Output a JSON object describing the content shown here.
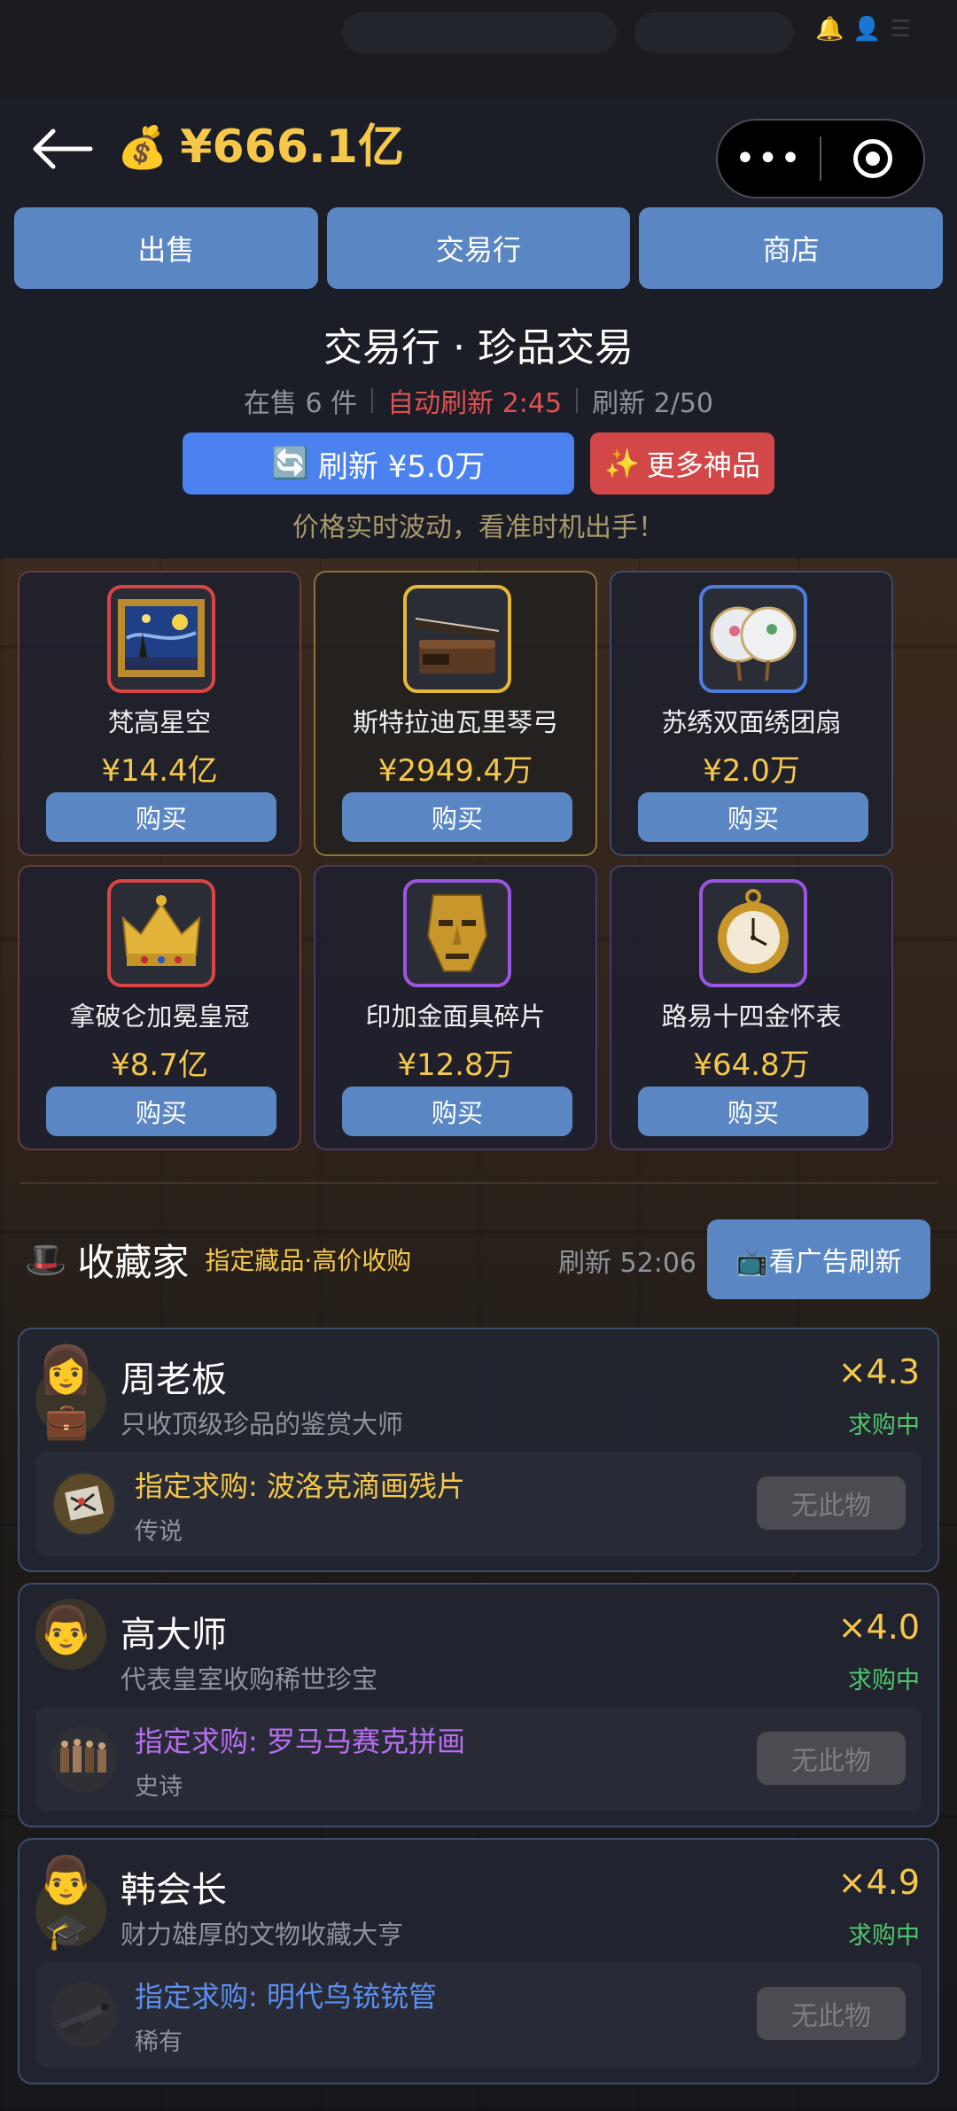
{
  "header": {
    "money": "¥666.1亿",
    "money_icon": "money-bag-icon"
  },
  "tabs": [
    {
      "label": "出售"
    },
    {
      "label": "交易行"
    },
    {
      "label": "商店"
    }
  ],
  "market": {
    "title": "交易行 · 珍品交易",
    "on_sale": "在售 6 件",
    "auto_refresh": "自动刷新 2:45",
    "refresh_count": "刷新 2/50",
    "refresh_button": "刷新 ¥5.0万",
    "more_button": "更多神品",
    "tip": "价格实时波动，看准时机出手！"
  },
  "items": [
    {
      "name": "梵高星空",
      "price": "¥14.4亿",
      "buy": "购买",
      "icon": "starry-night-painting-icon",
      "rarity_color": "#d94545"
    },
    {
      "name": "斯特拉迪瓦里琴弓",
      "price": "¥2949.4万",
      "buy": "购买",
      "icon": "violin-bow-icon",
      "rarity_color": "#e7b838"
    },
    {
      "name": "苏绣双面绣团扇",
      "price": "¥2.0万",
      "buy": "购买",
      "icon": "round-fan-icon",
      "rarity_color": "#4f7ddd"
    },
    {
      "name": "拿破仑加冕皇冠",
      "price": "¥8.7亿",
      "buy": "购买",
      "icon": "crown-icon",
      "rarity_color": "#d94545"
    },
    {
      "name": "印加金面具碎片",
      "price": "¥12.8万",
      "buy": "购买",
      "icon": "gold-mask-icon",
      "rarity_color": "#9b55e0"
    },
    {
      "name": "路易十四金怀表",
      "price": "¥64.8万",
      "buy": "购买",
      "icon": "pocket-watch-icon",
      "rarity_color": "#9b55e0"
    }
  ],
  "collectors_section": {
    "title": "收藏家",
    "subtitle": "指定藏品·高价收购",
    "refresh": "刷新 52:06",
    "ad_button": "📺看广告刷新"
  },
  "collectors": [
    {
      "name": "周老板",
      "desc": "只收顶级珍品的鉴赏大师",
      "multiplier": "×4.3",
      "status": "求购中",
      "wanted": "指定求购: 波洛克滴画残片",
      "rarity": "传说",
      "button": "无此物"
    },
    {
      "name": "高大师",
      "desc": "代表皇室收购稀世珍宝",
      "multiplier": "×4.0",
      "status": "求购中",
      "wanted": "指定求购: 罗马马赛克拼画",
      "rarity": "史诗",
      "button": "无此物"
    },
    {
      "name": "韩会长",
      "desc": "财力雄厚的文物收藏大亨",
      "multiplier": "×4.9",
      "status": "求购中",
      "wanted": "指定求购: 明代鸟铳铳管",
      "rarity": "稀有",
      "button": "无此物"
    }
  ]
}
